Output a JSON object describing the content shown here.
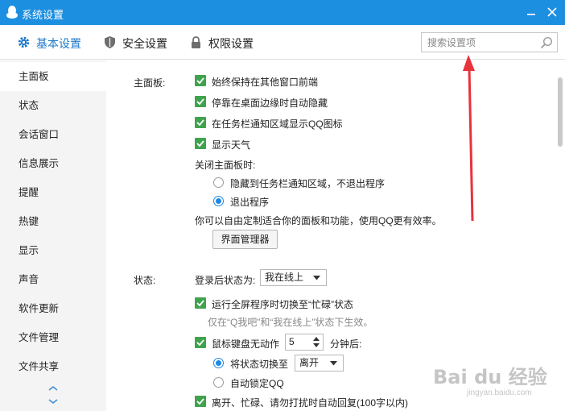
{
  "window": {
    "title": "系统设置"
  },
  "tabs": [
    {
      "label": "基本设置",
      "icon": "gear-icon",
      "active": true
    },
    {
      "label": "安全设置",
      "icon": "shield-icon"
    },
    {
      "label": "权限设置",
      "icon": "lock-icon"
    }
  ],
  "search": {
    "placeholder": "搜索设置项"
  },
  "sidebar": {
    "items": [
      "主面板",
      "状态",
      "会话窗口",
      "信息展示",
      "提醒",
      "热键",
      "显示",
      "声音",
      "软件更新",
      "文件管理",
      "文件共享"
    ]
  },
  "main_panel": {
    "label": "主面板:",
    "options": [
      "始终保持在其他窗口前端",
      "停靠在桌面边缘时自动隐藏",
      "在任务栏通知区域显示QQ图标",
      "显示天气"
    ],
    "close_label": "关闭主面板时:",
    "close_options": [
      "隐藏到任务栏通知区域，不退出程序",
      "退出程序"
    ],
    "close_selected": "退出程序",
    "description": "你可以自由定制适合你的面板和功能，使用QQ更有效率。",
    "manager_button": "界面管理器"
  },
  "status": {
    "label": "状态:",
    "login_label": "登录后状态为:",
    "login_value": "我在线上",
    "fullscreen_option": "运行全屏程序时切换至“忙碌”状态",
    "fullscreen_hint": "仅在“Q我吧”和“我在线上”状态下生效。",
    "idle_prefix": "鼠标键盘无动作",
    "idle_minutes": "5",
    "idle_suffix": "分钟后:",
    "switch_label": "将状态切换至",
    "switch_value": "离开",
    "lock_label": "自动锁定QQ",
    "auto_reply": "离开、忙碌、请勿打扰时自动回复(100字以内)"
  },
  "watermark": {
    "main": "Bai du 经验",
    "sub": "jingyan.baidu.com"
  },
  "colors": {
    "titlebar": "#1d8fe0",
    "accent": "#1e78c8",
    "check": "#3fa34d",
    "annotation_arrow": "#e8323c"
  }
}
